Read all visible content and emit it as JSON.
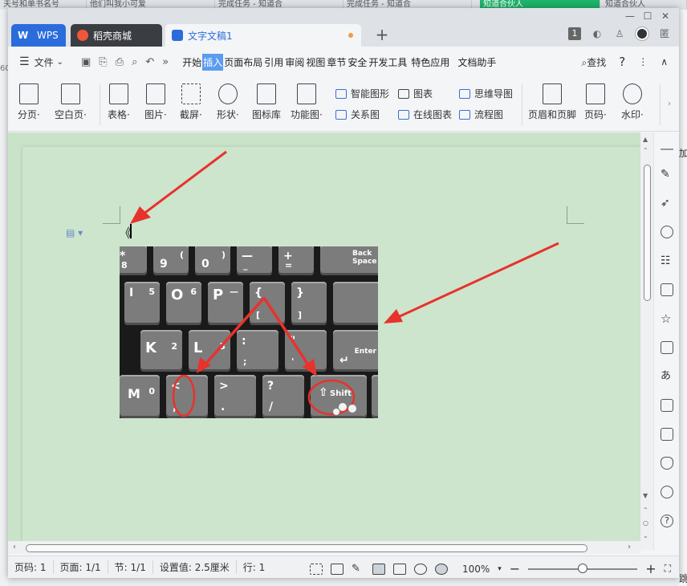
{
  "background": {
    "tabs": [
      "夫号和单书名号",
      "他们叫我小可爱",
      "完成任务 - 知道合",
      "完成任务 - 知道合",
      "知道合伙人",
      "知道合伙人"
    ],
    "left_text": "60",
    "right_texts": [
      "加",
      "跳"
    ]
  },
  "titlebar": {
    "tabs": [
      {
        "label": "WPS",
        "icon": "wps-logo-icon"
      },
      {
        "label": "稻壳商城",
        "icon": "docer-flame-icon"
      },
      {
        "label": "文字文稿1",
        "icon": "writer-doc-icon"
      }
    ],
    "new_tab": "+",
    "badge": "1",
    "user_label": "匿"
  },
  "menubar": {
    "file_label": "文件",
    "tabs": [
      "开始",
      "插入",
      "页面布局",
      "引用",
      "审阅",
      "视图",
      "章节",
      "安全",
      "开发工具",
      "特色应用",
      "文档助手"
    ],
    "active_tab": "插入",
    "search_label": "查找",
    "help": "?",
    "more": "⋮"
  },
  "ribbon": {
    "big_buttons": [
      "分页·",
      "空白页·",
      "表格·",
      "图片·",
      "截屏·",
      "形状·",
      "图标库",
      "功能图·"
    ],
    "small_buttons": [
      "智能图形",
      "图表",
      "思维导图",
      "关系图",
      "在线图表",
      "流程图"
    ],
    "right_buttons": [
      "页眉和页脚",
      "页码·",
      "水印·"
    ]
  },
  "document": {
    "cursor_text": "《"
  },
  "keyboard": {
    "keys": [
      {
        "main": "*",
        "sub": "8"
      },
      {
        "main": "9",
        "sub": "("
      },
      {
        "main": "0",
        "sub": ")"
      },
      {
        "main": "—",
        "sub": "_"
      },
      {
        "main": "+",
        "sub": "="
      },
      {
        "main": "Back Space",
        "sub": ""
      },
      {
        "main": "I",
        "sub": "5"
      },
      {
        "main": "O",
        "sub": "6"
      },
      {
        "main": "P",
        "sub": "—"
      },
      {
        "main": "{",
        "sub": "["
      },
      {
        "main": "}",
        "sub": "]"
      },
      {
        "main": "K",
        "sub": "2"
      },
      {
        "main": "L",
        "sub": "3"
      },
      {
        "main": ":",
        "sub": ";"
      },
      {
        "main": "\"",
        "sub": "'"
      },
      {
        "main": "Enter",
        "sub": "↵"
      },
      {
        "main": "M",
        "sub": "0"
      },
      {
        "main": "<",
        "sub": ","
      },
      {
        "main": ">",
        "sub": "."
      },
      {
        "main": "?",
        "sub": "/"
      },
      {
        "main": "Shift",
        "sub": "⇧"
      }
    ]
  },
  "statusbar": {
    "page_code": "页码: 1",
    "pages": "页面: 1/1",
    "section": "节: 1/1",
    "setting": "设置值: 2.5厘米",
    "row": "行: 1",
    "zoom": "100%",
    "zoom_minus": "−",
    "zoom_plus": "+",
    "zoom_level": 0.5
  },
  "colors": {
    "accent": "#2b6cdc",
    "doc_bg": "#cce5cc",
    "arrow": "#e8322c"
  }
}
